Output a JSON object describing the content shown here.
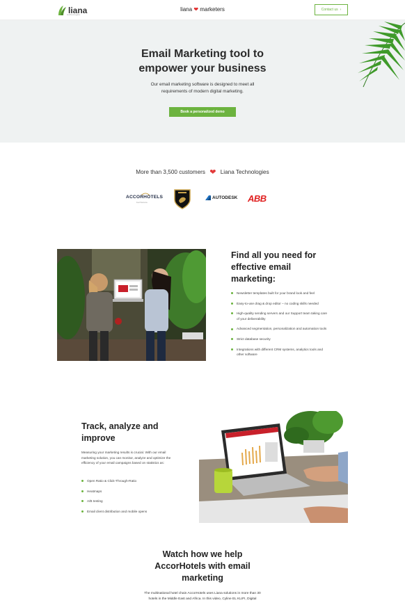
{
  "header": {
    "logo_text": "liana",
    "logo_sub": "technologies",
    "brand_left": "liana",
    "brand_right": "marketers",
    "contact_label": "Contact us",
    "contact_arrow": "›"
  },
  "hero": {
    "title_line1": "Email Marketing tool to",
    "title_line2": "empower your business",
    "subtitle_line1": "Our email marketing software is designed to meet all",
    "subtitle_line2": "requirements of modern digital marketing.",
    "cta_label": "Book a personalized demo"
  },
  "customers": {
    "left": "More than 3,500 customers",
    "right": "Liana Technologies",
    "logos": {
      "accor": "ACCORHOTELS",
      "accor_sub": "Feel Welcome",
      "autodesk": "AUTODESK",
      "abb": "ABB"
    }
  },
  "feature1": {
    "title_line1": "Find all you need for",
    "title_line2": "effective email",
    "title_line3": "marketing:",
    "items": [
      "Newsletter templates built for your brand look and feel",
      "Easy-to-use drag & drop editor – no coding skills needed",
      "High-quality sending servers and our Support team taking care of your deliverability",
      "Advanced segmentation, personalization and automation tools",
      "Strict database security",
      "Integrations with different CRM systems, analytics tools and other software"
    ]
  },
  "feature2": {
    "title_line1": "Track, analyze and",
    "title_line2": "improve",
    "body": "Measuring your marketing results is crucial. With our email marketing solution, you can monitor, analyze and optimize the efficiency of your email campaigns based on statistics as:",
    "items": [
      "Open Ratio & Click-Through-Ratio",
      "Heatmaps",
      "A/B testing",
      "Email client distribution and mobile opens"
    ]
  },
  "video": {
    "title_line1": "Watch how we help",
    "title_line2": "AccorHotels with email",
    "title_line3": "marketing",
    "body_line1": "The multinational hotel chain AccorHotels uses Liana solutions in more than 30",
    "body_line2": "hotels in the Middle East and Africa. In this video, Cyline EL KLIFI, Digital"
  },
  "colors": {
    "accent_green": "#6cb33f",
    "heart_red": "#e22a2a",
    "hero_bg": "#eff2f2"
  }
}
